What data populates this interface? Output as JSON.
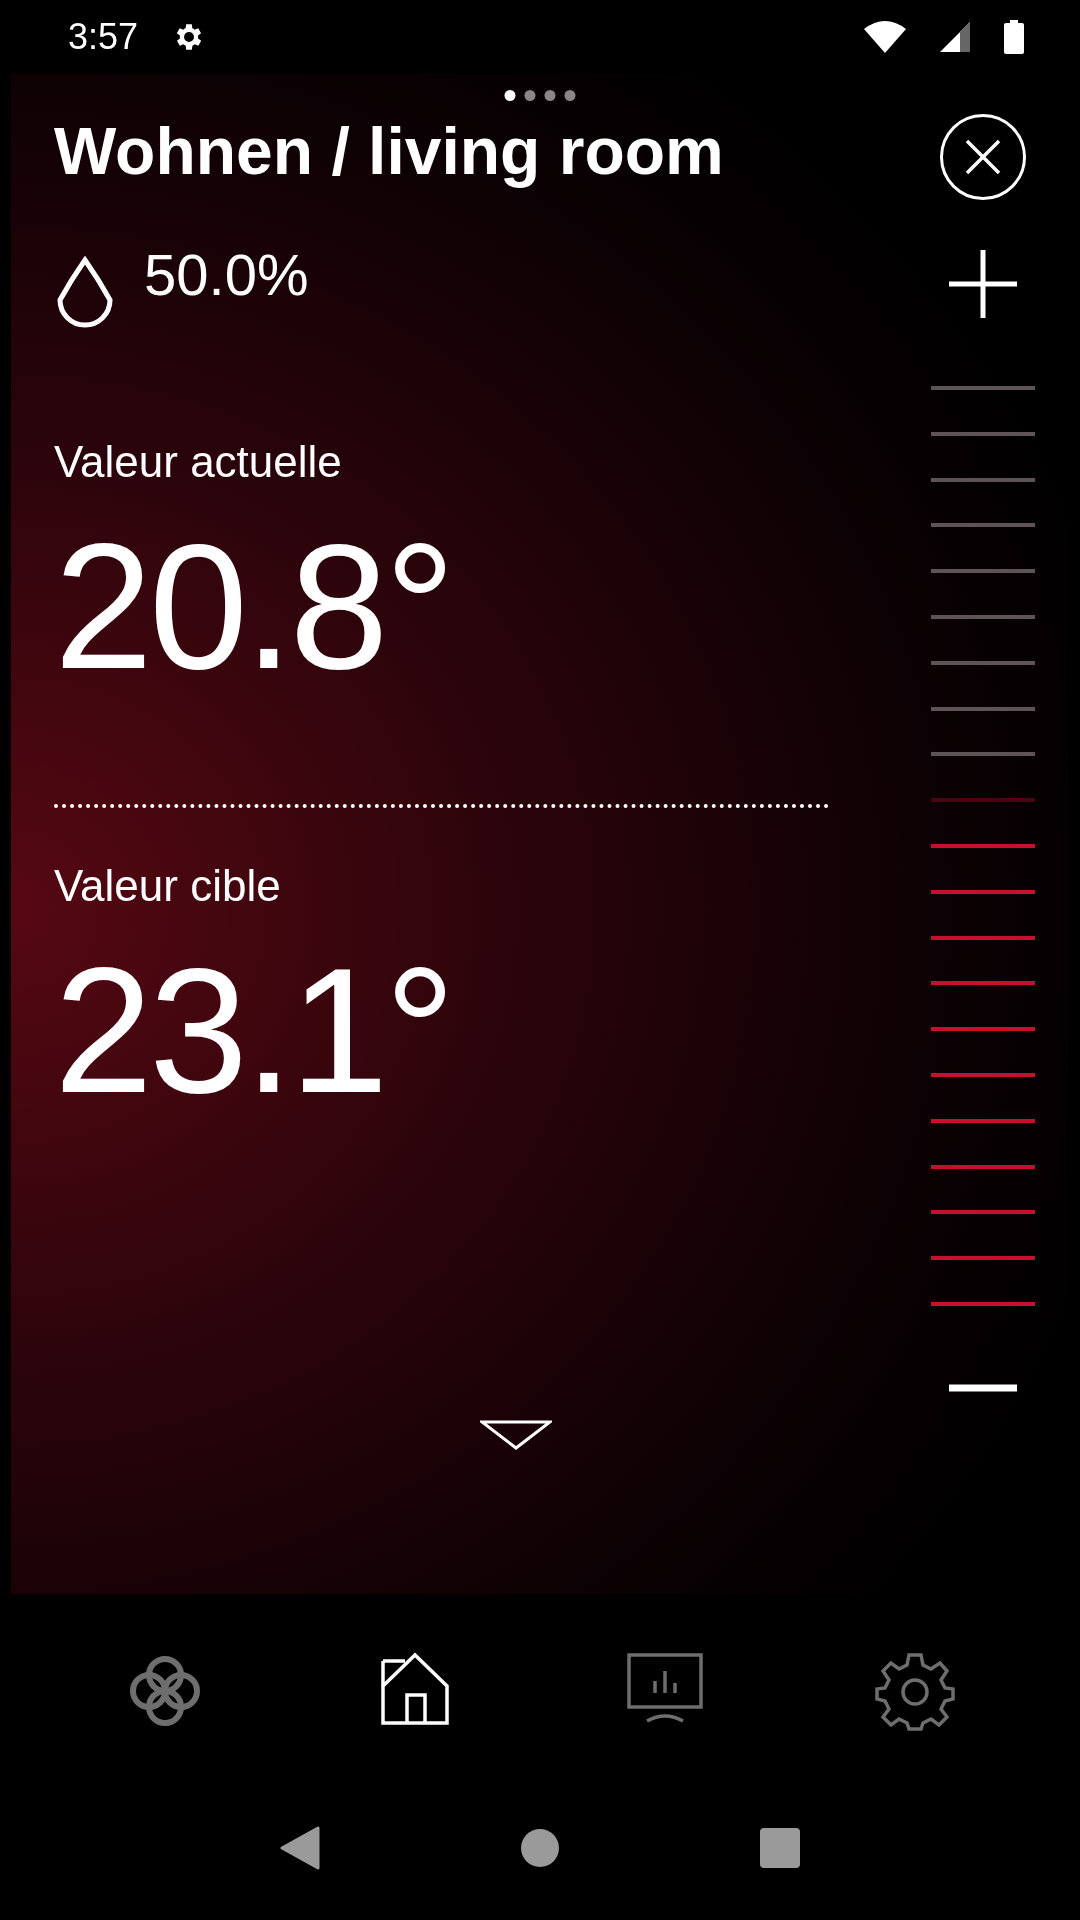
{
  "status_bar": {
    "time": "3:57"
  },
  "pager": [
    {
      "selected": true
    },
    {
      "selected": false
    },
    {
      "selected": false
    },
    {
      "selected": false
    }
  ],
  "room": {
    "title": "Wohnen / living room",
    "humidity": "50.0%"
  },
  "current": {
    "label": "Valeur actuelle",
    "value": "20.8°"
  },
  "target": {
    "label": "Valeur cible",
    "value": "23.1°"
  },
  "setpoint_scale": {
    "level": 0.524
  },
  "bottom_nav": [
    {
      "kind": "knot",
      "selected": false
    },
    {
      "kind": "home",
      "selected": true
    },
    {
      "kind": "chart",
      "selected": false
    },
    {
      "kind": "gear",
      "selected": false
    }
  ]
}
